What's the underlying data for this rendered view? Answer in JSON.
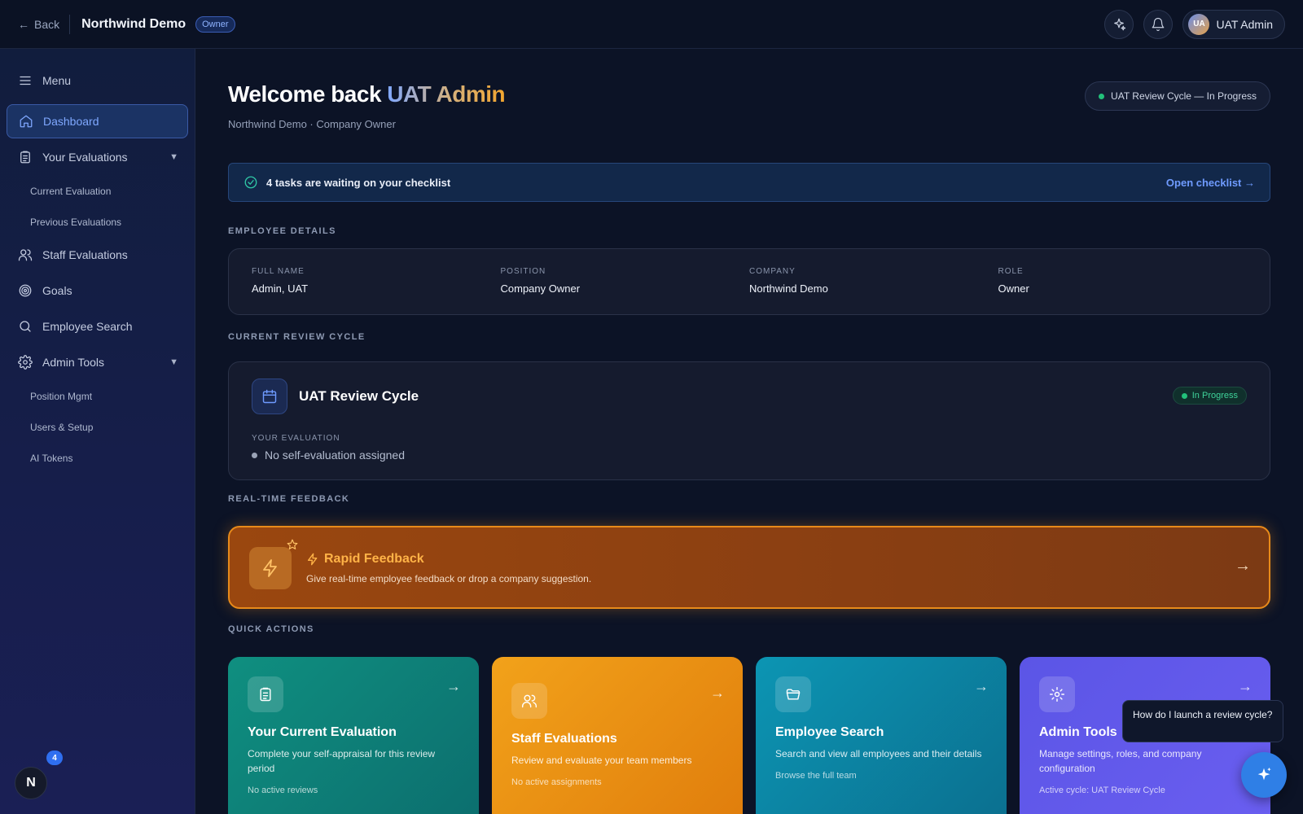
{
  "topbar": {
    "back_label": "Back",
    "org_title": "Northwind Demo",
    "org_badge": "Owner",
    "user_initials": "UA",
    "user_name": "UAT Admin"
  },
  "sidebar": {
    "menu_label": "Menu",
    "items": [
      {
        "label": "Dashboard",
        "icon": "home-icon",
        "active": true
      },
      {
        "label": "Your Evaluations",
        "icon": "clipboard-icon",
        "expandable": true
      },
      {
        "label": "Staff Evaluations",
        "icon": "users-icon"
      },
      {
        "label": "Goals",
        "icon": "target-icon"
      },
      {
        "label": "Employee Search",
        "icon": "search-icon"
      },
      {
        "label": "Admin Tools",
        "icon": "gear-icon",
        "expandable": true
      }
    ],
    "your_eval_sub": [
      "Current Evaluation",
      "Previous Evaluations"
    ],
    "admin_sub": [
      "Position Mgmt",
      "Users & Setup",
      "AI Tokens"
    ]
  },
  "header": {
    "welcome_prefix": "Welcome back ",
    "welcome_name": "UAT Admin",
    "subtitle": "Northwind Demo · Company Owner",
    "cycle_pill": "UAT Review Cycle — In Progress"
  },
  "checklist": {
    "text": "4 tasks are waiting on your checklist",
    "link": "Open checklist →"
  },
  "employee_details": {
    "section": "EMPLOYEE DETAILS",
    "fields": [
      {
        "label": "FULL NAME",
        "value": "Admin, UAT"
      },
      {
        "label": "POSITION",
        "value": "Company Owner"
      },
      {
        "label": "COMPANY",
        "value": "Northwind Demo"
      },
      {
        "label": "ROLE",
        "value": "Owner"
      }
    ]
  },
  "review_cycle": {
    "section": "CURRENT REVIEW CYCLE",
    "title": "UAT Review Cycle",
    "status": "In Progress",
    "your_eval_label": "YOUR EVALUATION",
    "your_eval_value": "No self-evaluation assigned"
  },
  "feedback": {
    "section": "REAL-TIME FEEDBACK",
    "title": "Rapid Feedback",
    "desc": "Give real-time employee feedback or drop a company suggestion."
  },
  "quick_actions": {
    "section": "QUICK ACTIONS",
    "cards": [
      {
        "title": "Your Current Evaluation",
        "desc": "Complete your self-appraisal for this review period",
        "foot": "No active reviews"
      },
      {
        "title": "Staff Evaluations",
        "desc": "Review and evaluate your team members",
        "foot": "No active assignments"
      },
      {
        "title": "Employee Search",
        "desc": "Search and view all employees and their details",
        "foot": "Browse the full team"
      },
      {
        "title": "Admin Tools",
        "desc": "Manage settings, roles, and company configuration",
        "foot": "Active cycle: UAT Review Cycle"
      }
    ]
  },
  "assistant": {
    "tooltip": "How do I launch a review cycle?"
  },
  "notifications": {
    "avatar_letter": "N",
    "count": "4"
  },
  "colors": {
    "accent": "#7fa8ff",
    "success": "#22c07a",
    "feedback_border": "#e88a1a"
  }
}
